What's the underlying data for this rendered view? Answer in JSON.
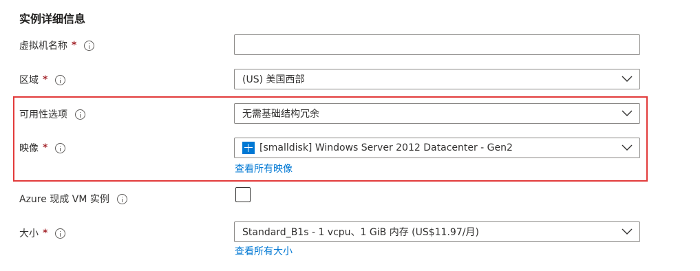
{
  "section_title": "实例详细信息",
  "fields": {
    "vm_name": {
      "label": "虚拟机名称",
      "required": "*",
      "value": ""
    },
    "region": {
      "label": "区域",
      "required": "*",
      "value": "(US) 美国西部"
    },
    "availability": {
      "label": "可用性选项",
      "value": "无需基础结构冗余"
    },
    "image": {
      "label": "映像",
      "required": "*",
      "value": "[smalldisk] Windows Server 2012 Datacenter - Gen2",
      "link": "查看所有映像",
      "icon": "windows-icon"
    },
    "spot": {
      "label": "Azure 现成 VM 实例",
      "checked": false
    },
    "size": {
      "label": "大小",
      "required": "*",
      "value": "Standard_B1s - 1 vcpu、1 GiB 内存 (US$11.97/月)",
      "link": "查看所有大小"
    }
  },
  "colors": {
    "required": "#a4262c",
    "link": "#0078d4",
    "highlight_border": "#e23a3a",
    "input_border": "#8a8886"
  }
}
